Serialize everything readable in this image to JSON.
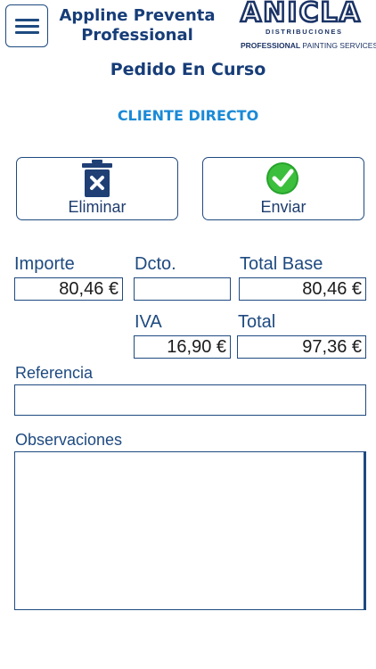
{
  "header": {
    "title_line1": "Appline Preventa",
    "title_line2": "Professional",
    "logo": {
      "word": "ANICLA",
      "sub": "DISTRIBUCIONES",
      "tag_bold": "PROFESSIONAL",
      "tag_rest": " PAINTING SERVICES"
    }
  },
  "page": {
    "title": "Pedido En Curso",
    "client": "CLIENTE DIRECTO"
  },
  "actions": {
    "delete_label": "Eliminar",
    "send_label": "Enviar"
  },
  "totals": {
    "importe_label": "Importe",
    "importe_value": "80,46 €",
    "dcto_label": "Dcto.",
    "dcto_value": "",
    "total_base_label": "Total Base",
    "total_base_value": "80,46 €",
    "iva_label": "IVA",
    "iva_value": "16,90 €",
    "total_label": "Total",
    "total_value": "97,36 €"
  },
  "form": {
    "referencia_label": "Referencia",
    "referencia_value": "",
    "observaciones_label": "Observaciones",
    "observaciones_value": ""
  },
  "colors": {
    "primary": "#1e4a80",
    "title": "#173d78",
    "accent": "#1a8ad6",
    "check": "#27a32c",
    "trash": "#1f3f75"
  }
}
